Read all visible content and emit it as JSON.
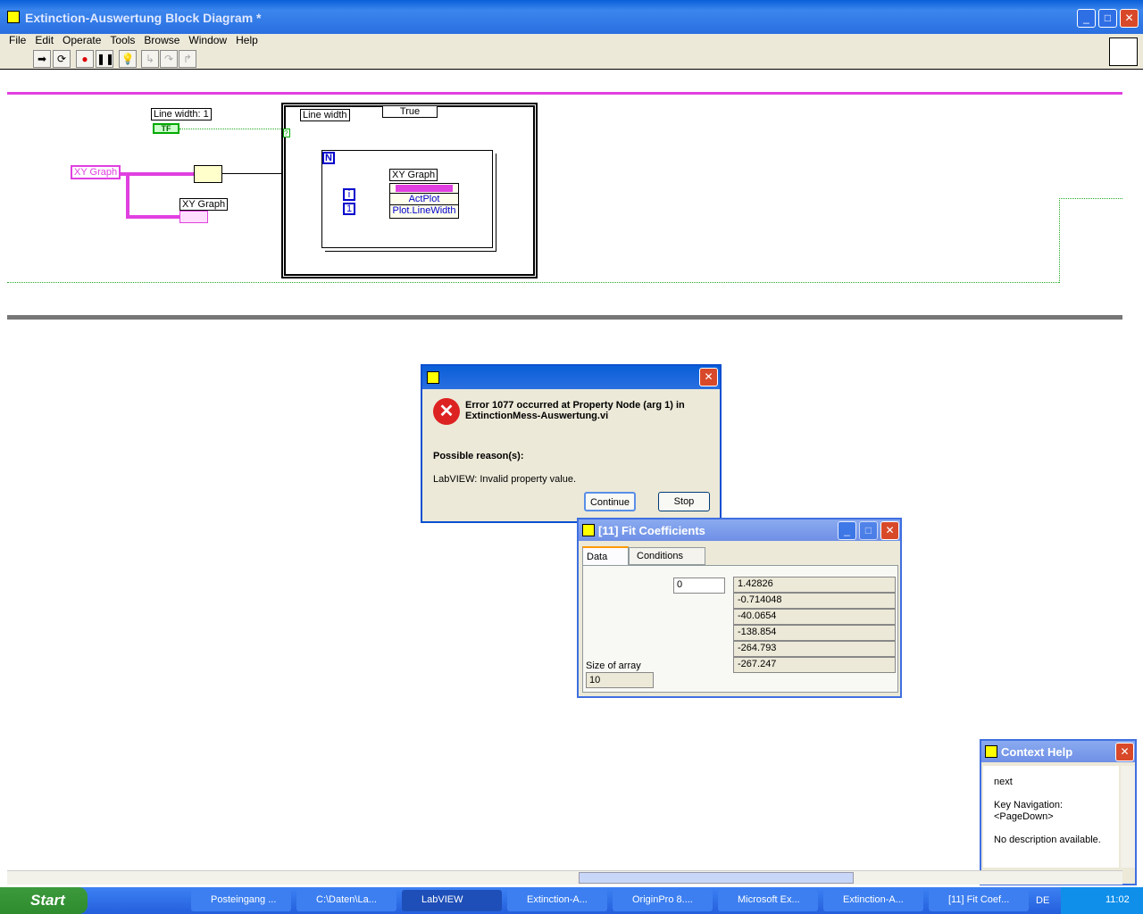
{
  "window": {
    "title": "Extinction-Auswertung Block Diagram *",
    "minimize": "_",
    "maximize": "□",
    "close": "✕"
  },
  "menu": [
    "File",
    "Edit",
    "Operate",
    "Tools",
    "Browse",
    "Window",
    "Help"
  ],
  "toolbar": [
    "run",
    "run-continuously",
    "abort",
    "pause",
    "highlight-execution",
    "step-into",
    "step-over",
    "step-out"
  ],
  "diagram": {
    "line_width_label": "Line width: 1",
    "tf_constant": "TF",
    "xy_graph_control": "XY Graph",
    "xy_graph_ref": "XY Graph",
    "case_label": "Line width",
    "case_selector": "True",
    "loop_n": "N",
    "loop_i": "i",
    "const_one": "1",
    "node_name": "XY Graph",
    "prop_actplot": "ActPlot",
    "prop_linewidth": "Plot.LineWidth",
    "qmark": "?"
  },
  "error_dialog": {
    "heading": "Error 1077 occurred at Property Node (arg 1) in ExtinctionMess-Auswertung.vi",
    "reasons_title": "Possible reason(s):",
    "reason": "LabVIEW:  Invalid property value.",
    "continue": "Continue",
    "stop": "Stop"
  },
  "fit_window": {
    "title": "[11] Fit Coefficients",
    "tabs": [
      "Data",
      "Conditions"
    ],
    "index": "0",
    "values": [
      "1.42826",
      "-0.714048",
      "-40.0654",
      "-138.854",
      "-264.793",
      "-267.247"
    ],
    "size_label": "Size of array",
    "size_value": "10"
  },
  "context_help": {
    "title": "Context Help",
    "line1": "next",
    "line2": "Key Navigation:",
    "line3": "<PageDown>",
    "line4": "No description available."
  },
  "taskbar": {
    "start": "Start",
    "items": [
      "Posteingang ...",
      "C:\\Daten\\La...",
      "LabVIEW",
      "Extinction-A...",
      "OriginPro 8....",
      "Microsoft Ex...",
      "Extinction-A...",
      "[11] Fit Coef..."
    ],
    "lang": "DE",
    "clock": "11:02"
  }
}
